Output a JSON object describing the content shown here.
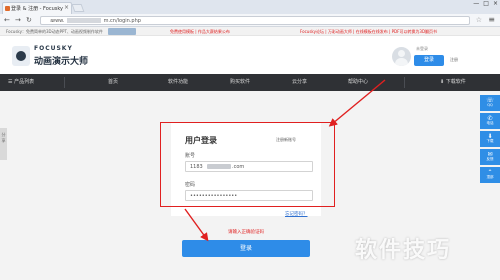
{
  "browser": {
    "tab_title": "登录 & 注册 - Focusky",
    "tab_close": "×",
    "new_tab": "",
    "window_controls": [
      "—",
      "□",
      "×"
    ],
    "url_prefix": "www.",
    "url_path": "m.cn/login.php",
    "nav": {
      "back": "←",
      "forward": "→",
      "reload": "↻"
    },
    "star": "☆",
    "menu": "≡"
  },
  "infobar": {
    "left_text": "Focusky：免费简单的3D动态PPT、动画视频制作软件",
    "red1": "免费使用模板 | 作品大赛结果公布",
    "links_right": "Focusky论坛 | 万彩动画大师 | 在线模板在线发布 | PDF可以转换为3D翻页书"
  },
  "header": {
    "logo_en": "FOCUSKY",
    "logo_cn": "动画演示大师",
    "user_hint": "未登录",
    "login_button": "登录",
    "register_link": "注册"
  },
  "nav": {
    "items": [
      "☰ 产品列表",
      "首页",
      "软件功能",
      "购买软件",
      "云分享",
      "帮助中心",
      "⬇ 下载软件"
    ]
  },
  "side_tab": {
    "label": "分享"
  },
  "login_form": {
    "title": "用户登录",
    "register_link": "注册新账号",
    "account_label": "账号",
    "account_prefix": "1183",
    "account_suffix": ".com",
    "password_label": "密码",
    "password_value": "••••••••••••••••",
    "forgot_link": "忘记密码？",
    "error_message": "请输入正确验证码",
    "submit_label": "登录"
  },
  "right_rail": [
    {
      "icon": "☏",
      "label": "QQ"
    },
    {
      "icon": "✆",
      "label": "电话"
    },
    {
      "icon": "⬇",
      "label": "下载"
    },
    {
      "icon": "✉",
      "label": "反馈"
    },
    {
      "icon": "⌃",
      "label": "顶部"
    }
  ],
  "watermark": "软件技巧",
  "colors": {
    "accent": "#2e8ce8",
    "annotation": "#e02020",
    "nav_bg": "#2f3135"
  }
}
